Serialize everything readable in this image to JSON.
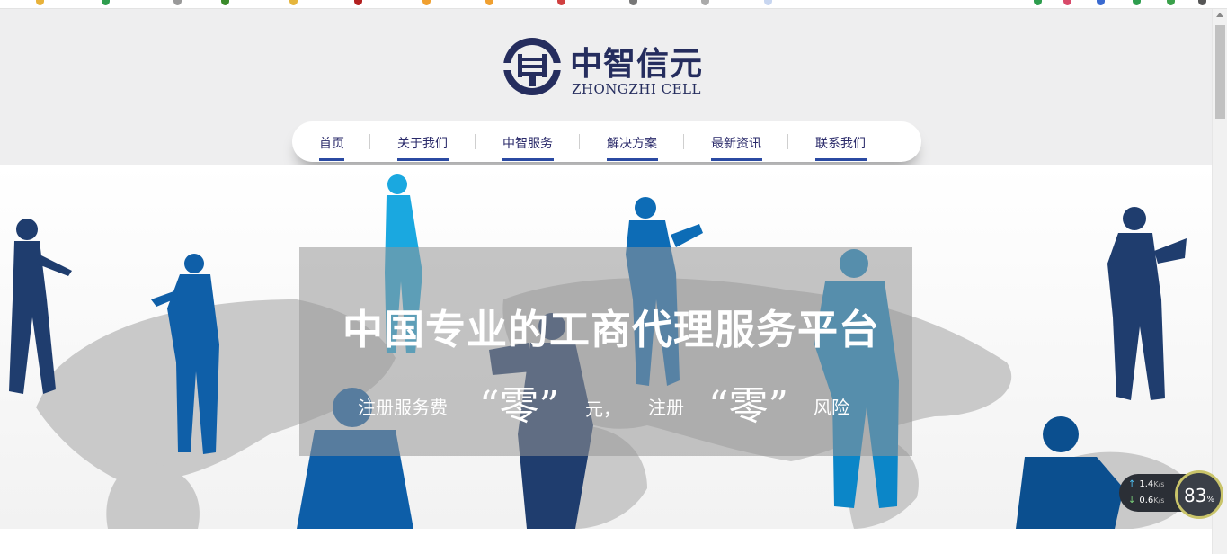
{
  "brand": {
    "name_cn": "中智信元",
    "name_en": "ZHONGZHI CELL",
    "color": "#252d5e"
  },
  "nav": {
    "items": [
      {
        "label": "首页"
      },
      {
        "label": "关于我们"
      },
      {
        "label": "中智服务"
      },
      {
        "label": "解决方案"
      },
      {
        "label": "最新资讯"
      },
      {
        "label": "联系我们"
      }
    ],
    "accent": "#2b4aa2"
  },
  "hero": {
    "headline": "中国专业的工商代理服务平台",
    "sub_prefix": "注册服务费",
    "quote1": "“零”",
    "sub_mid1": "元，",
    "sub_mid2": "注册",
    "quote2": "“零”",
    "sub_suffix": "风险"
  },
  "speed_widget": {
    "upload": "1.4",
    "download": "0.6",
    "unit": "K/s",
    "percent": "83",
    "percent_sign": "%"
  }
}
